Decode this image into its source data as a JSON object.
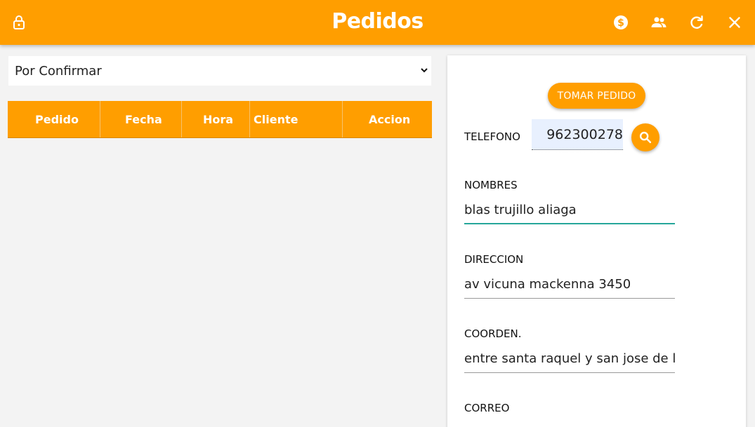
{
  "header": {
    "title": "Pedidos",
    "bg_color": "#ff9e00",
    "icons": [
      "lock-icon",
      "dollar-icon",
      "people-icon",
      "refresh-icon",
      "close-icon"
    ]
  },
  "filter": {
    "selected": "Por Confirmar"
  },
  "orders_table": {
    "columns": [
      "Pedido",
      "Fecha",
      "Hora",
      "Cliente",
      "Accion"
    ],
    "rows": []
  },
  "form": {
    "take_order_label": "TOMAR PEDIDO",
    "phone_label": "TELEFONO",
    "phone_value": "962300278",
    "names_label": "NOMBRES",
    "names_value": "blas trujillo aliaga",
    "address_label": "DIRECCION",
    "address_value": "av vicuna mackenna 3450",
    "coords_label": "COORDEN.",
    "coords_value": "entre santa raquel y san jose de la",
    "email_label": "CORREO",
    "focus_color": "#26a69a"
  }
}
